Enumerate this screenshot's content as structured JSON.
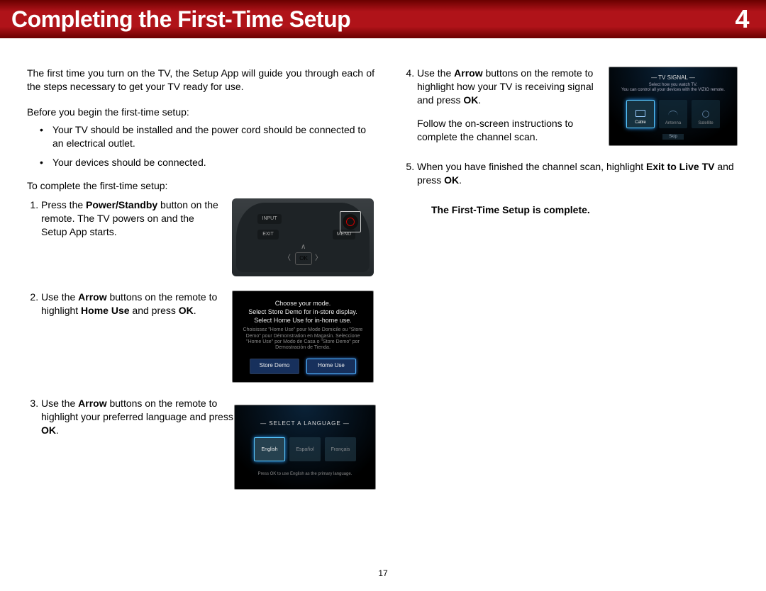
{
  "header": {
    "title": "Completing the First-Time Setup",
    "chapter": "4"
  },
  "intro": "The first time you turn on the TV, the Setup App will guide you through each of the steps necessary to get your TV ready for use.",
  "before_label": "Before you begin the first-time setup:",
  "before_bullets": [
    "Your TV should be installed and the power cord should be connected to an electrical outlet.",
    "Your devices should be connected."
  ],
  "to_complete_label": "To complete the first-time setup:",
  "step1": {
    "pre": "Press the ",
    "bold": "Power/Standby",
    "post": " button on the remote. The TV powers on and the Setup App starts."
  },
  "remote": {
    "input": "INPUT",
    "exit": "EXIT",
    "menu": "MENU",
    "ok": "OK"
  },
  "step2": {
    "pre": "Use the ",
    "b1": "Arrow",
    "mid": " buttons on the remote to highlight ",
    "b2": "Home Use",
    "post1": " and press ",
    "b3": "OK",
    "post2": "."
  },
  "mode_fig": {
    "line1": "Choose your mode.",
    "line2": "Select Store Demo for in-store display.",
    "line3": "Select Home Use for in-home use.",
    "sub": "Choisissez \"Home Use\" pour Mode Domicile ou \"Store Demo\" pour Démonstration en Magasin. Seleccione \"Home Use\" por Modo de Casa o \"Store Demo\" por Demostración de Tienda.",
    "btn_store": "Store Demo",
    "btn_home": "Home Use"
  },
  "step3": {
    "pre": "Use the ",
    "b1": "Arrow",
    "mid": " buttons on the remote to highlight your preferred language and press ",
    "b2": "OK",
    "post": "."
  },
  "lang_fig": {
    "hdr": "SELECT A LANGUAGE",
    "en": "English",
    "es": "Español",
    "fr": "Français",
    "foot": "Press OK to use English as the primary language."
  },
  "step4": {
    "pre": "Use the ",
    "b1": "Arrow",
    "mid": " buttons on the remote to highlight how your TV is receiving signal and press ",
    "b2": "OK",
    "post": ".",
    "follow": "Follow the on-screen instructions to complete the channel scan."
  },
  "sig_fig": {
    "hdr": "TV SIGNAL",
    "sub": "Select how you watch TV.\nYou can control all your devices with the VIZIO remote.",
    "cable": "Cable",
    "antenna": "Antenna",
    "satellite": "Satellite",
    "skip": "Skip"
  },
  "step5": {
    "pre": "When you have finished the channel scan, highlight ",
    "b1": "Exit to Live TV",
    "mid": " and press ",
    "b2": "OK",
    "post": "."
  },
  "complete": "The First-Time Setup is complete.",
  "page_number": "17"
}
